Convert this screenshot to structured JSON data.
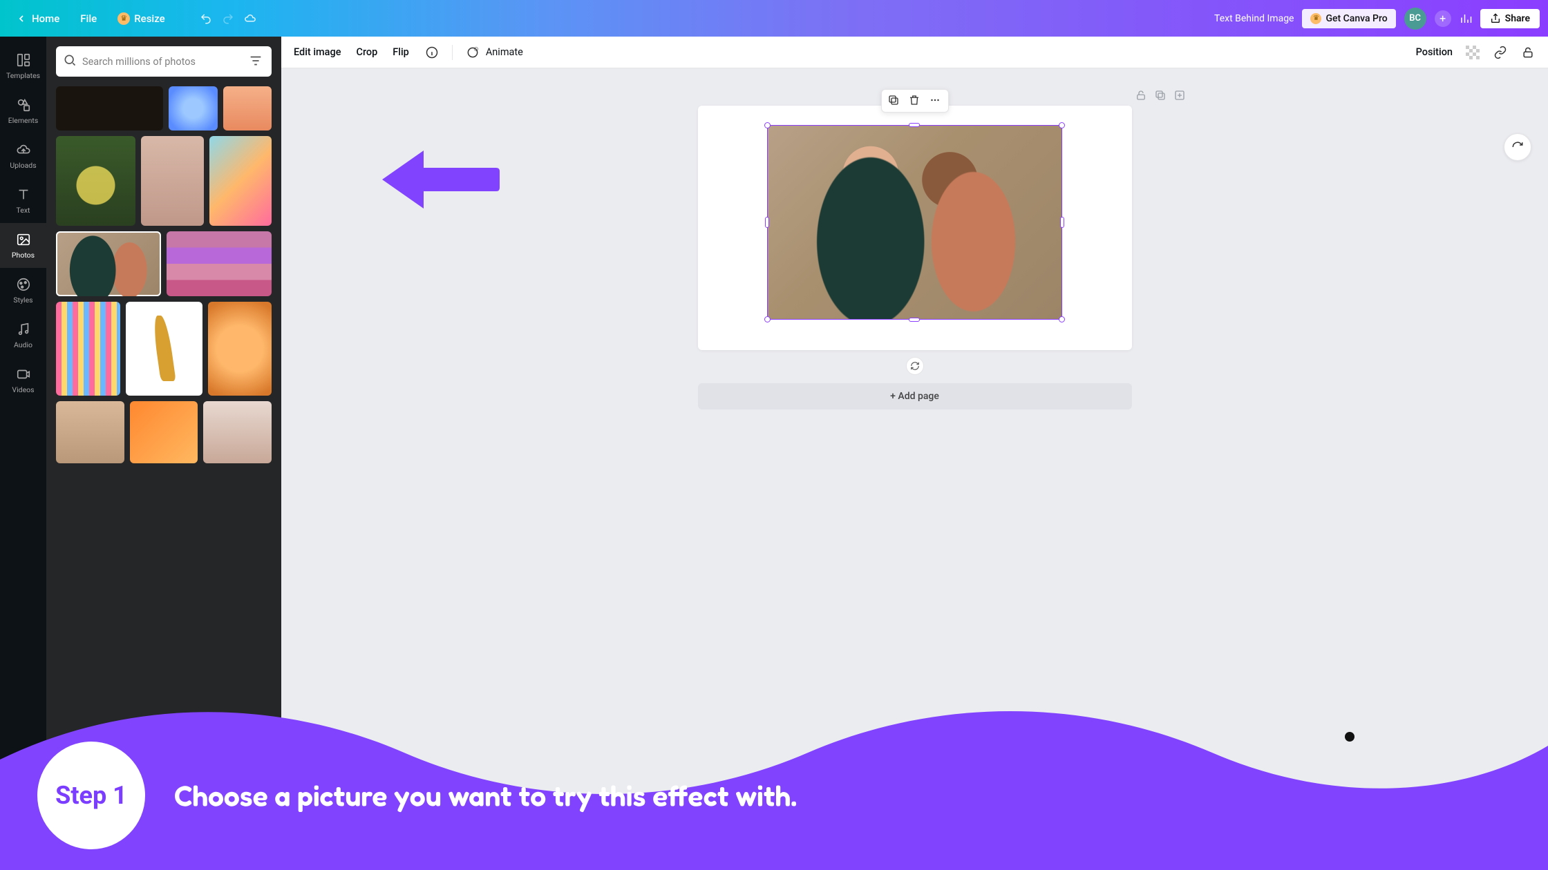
{
  "topbar": {
    "home": "Home",
    "file": "File",
    "resize": "Resize",
    "doc_title": "Text Behind Image",
    "pro": "Get Canva Pro",
    "avatar": "BC",
    "share": "Share"
  },
  "rail": {
    "templates": "Templates",
    "elements": "Elements",
    "uploads": "Uploads",
    "text": "Text",
    "photos": "Photos",
    "styles": "Styles",
    "audio": "Audio",
    "videos": "Videos"
  },
  "panel": {
    "search_placeholder": "Search millions of photos"
  },
  "ctx": {
    "edit_image": "Edit image",
    "crop": "Crop",
    "flip": "Flip",
    "animate": "Animate",
    "position": "Position"
  },
  "canvas": {
    "add_page": "+ Add page"
  },
  "step": {
    "label": "Step 1",
    "text": "Choose a picture you want to try this effect with."
  },
  "colors": {
    "accent": "#8b3dff",
    "overlay": "#7b3dff"
  }
}
